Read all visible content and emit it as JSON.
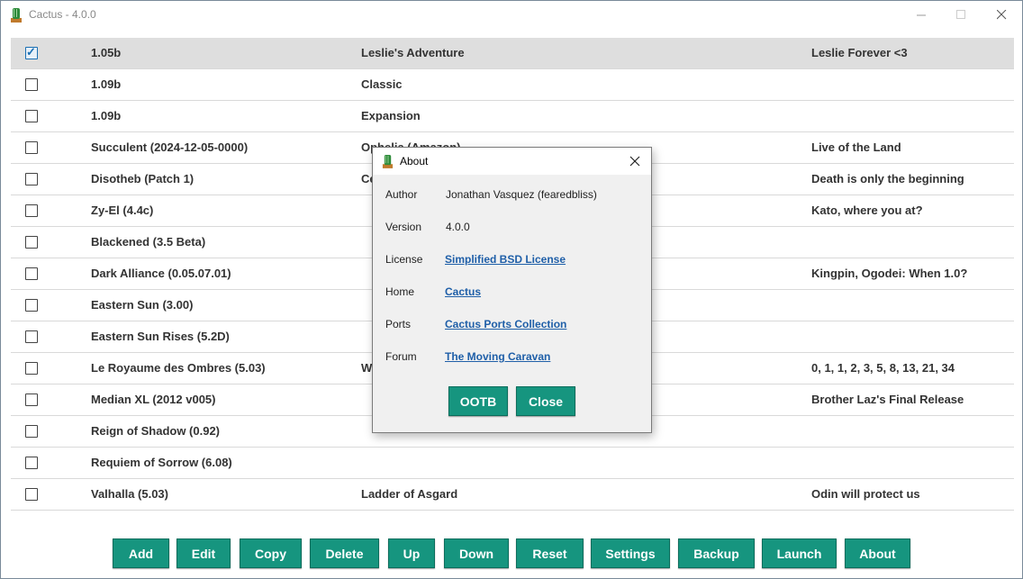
{
  "window": {
    "title": "Cactus - 4.0.0",
    "icon": "cactus-icon"
  },
  "rows": [
    {
      "checked": true,
      "version": "1.05b",
      "name": "Leslie's Adventure",
      "notes": "Leslie Forever <3"
    },
    {
      "checked": false,
      "version": "1.09b",
      "name": "Classic",
      "notes": ""
    },
    {
      "checked": false,
      "version": "1.09b",
      "name": "Expansion",
      "notes": ""
    },
    {
      "checked": false,
      "version": "Succulent (2024-12-05-0000)",
      "name": "Ophelia (Amazon)",
      "notes": "Live of the Land"
    },
    {
      "checked": false,
      "version": "Disotheb (Patch 1)",
      "name": "Ce",
      "notes": "Death is only the beginning"
    },
    {
      "checked": false,
      "version": "Zy-El (4.4c)",
      "name": "",
      "notes": "Kato, where you at?"
    },
    {
      "checked": false,
      "version": "Blackened (3.5 Beta)",
      "name": "",
      "notes": ""
    },
    {
      "checked": false,
      "version": "Dark Alliance (0.05.07.01)",
      "name": "",
      "notes": "Kingpin, Ogodei: When 1.0?"
    },
    {
      "checked": false,
      "version": "Eastern Sun (3.00)",
      "name": "",
      "notes": ""
    },
    {
      "checked": false,
      "version": "Eastern Sun Rises (5.2D)",
      "name": "",
      "notes": ""
    },
    {
      "checked": false,
      "version": "Le Royaume des Ombres (5.03)",
      "name": "Wi",
      "notes": "0, 1, 1, 2, 3, 5, 8, 13, 21, 34"
    },
    {
      "checked": false,
      "version": "Median XL (2012 v005)",
      "name": "",
      "notes": "Brother Laz's Final Release"
    },
    {
      "checked": false,
      "version": "Reign of Shadow (0.92)",
      "name": "",
      "notes": ""
    },
    {
      "checked": false,
      "version": "Requiem of Sorrow (6.08)",
      "name": "",
      "notes": ""
    },
    {
      "checked": false,
      "version": "Valhalla (5.03)",
      "name": "Ladder of Asgard",
      "notes": "Odin will protect us"
    }
  ],
  "toolbar": {
    "buttons": [
      "Add",
      "Edit",
      "Copy",
      "Delete",
      "Up",
      "Down",
      "Reset",
      "Settings",
      "Backup",
      "Launch",
      "About"
    ]
  },
  "about": {
    "title": "About",
    "author_label": "Author",
    "author": "Jonathan Vasquez (fearedbliss)",
    "version_label": "Version",
    "version": "4.0.0",
    "license_label": "License",
    "license": "Simplified BSD License",
    "home_label": "Home",
    "home": "Cactus",
    "ports_label": "Ports",
    "ports": "Cactus Ports Collection",
    "forum_label": "Forum",
    "forum": "The Moving Caravan",
    "ootb_label": "OOTB",
    "close_label": "Close"
  },
  "colors": {
    "accent": "#16957f",
    "link": "#1f5fa8",
    "selected_row": "#dedede"
  }
}
